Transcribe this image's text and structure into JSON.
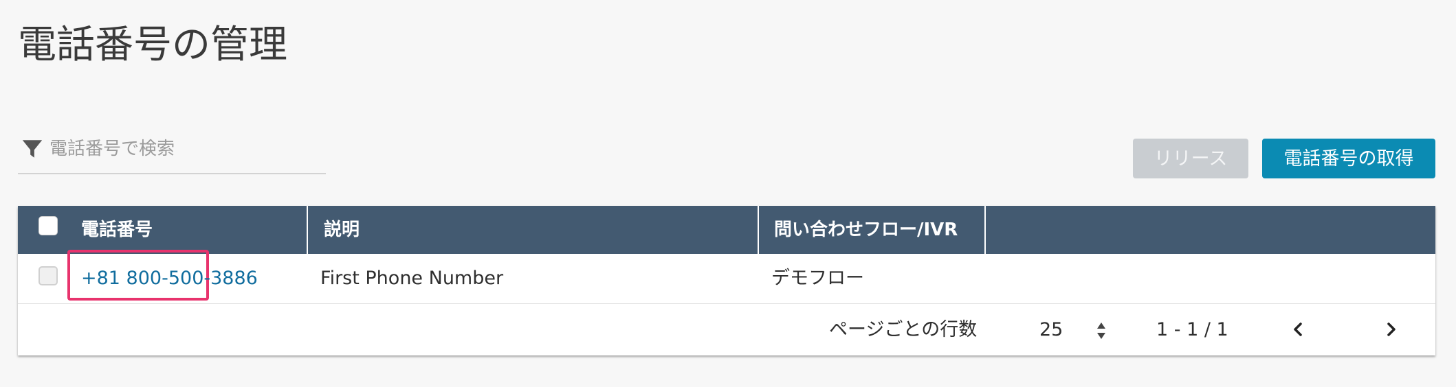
{
  "page": {
    "title": "電話番号の管理"
  },
  "search": {
    "placeholder": "電話番号で検索",
    "value": ""
  },
  "toolbar": {
    "release_label": "リリース",
    "claim_label": "電話番号の取得"
  },
  "table": {
    "columns": [
      "電話番号",
      "説明",
      "問い合わせフロー/IVR"
    ],
    "rows": [
      {
        "phone": "+81 800-500-3886",
        "description": "First Phone Number",
        "flow": "デモフロー"
      }
    ]
  },
  "pagination": {
    "rows_per_page_label": "ページごとの行数",
    "rows_per_page": "25",
    "range": "1 - 1 / 1"
  },
  "colors": {
    "header_bg": "#435a71",
    "primary_button": "#0b8bb3",
    "disabled_button": "#c9cdd1",
    "link": "#116d9e",
    "highlight": "#e8336d"
  }
}
